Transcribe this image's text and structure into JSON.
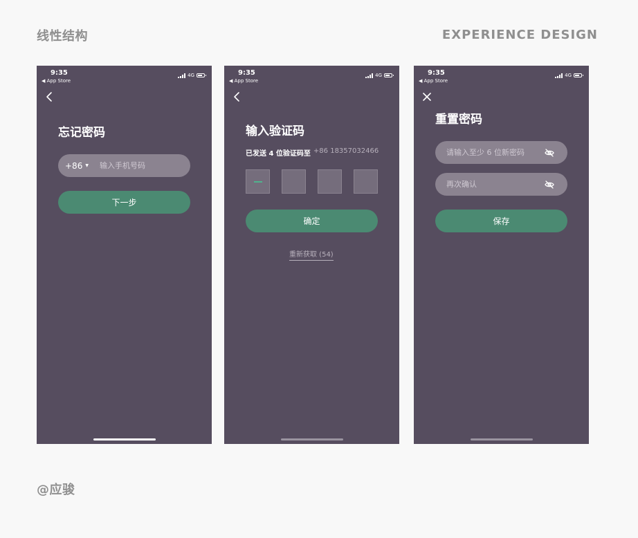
{
  "page": {
    "title": "线性结构",
    "subtitle": "EXPERIENCE DESIGN",
    "author": "@应骏"
  },
  "status_bar": {
    "time": "9:35",
    "back_app": "◀ App Store",
    "network": "4G"
  },
  "screens": [
    {
      "nav_icon": "back-chevron-icon",
      "title": "忘记密码",
      "country_code": "+86",
      "phone_placeholder": "输入手机号码",
      "next_button": "下一步"
    },
    {
      "nav_icon": "back-chevron-icon",
      "title": "输入验证码",
      "sent_label": "已发送 4 位验证码至",
      "sent_phone": "+86 18357032466",
      "code_digits": 4,
      "confirm_button": "确定",
      "resend": "重新获取 (54)"
    },
    {
      "nav_icon": "close-icon",
      "title": "重置密码",
      "new_password_placeholder": "请输入至少 6 位新密码",
      "confirm_placeholder": "再次确认",
      "save_button": "保存"
    }
  ],
  "colors": {
    "page_background": "#f8f8f8",
    "screen_background": "#564d5f",
    "input_background": "#8b8390",
    "accent_green": "#4b8a72",
    "muted_text": "#8f8f8f"
  }
}
